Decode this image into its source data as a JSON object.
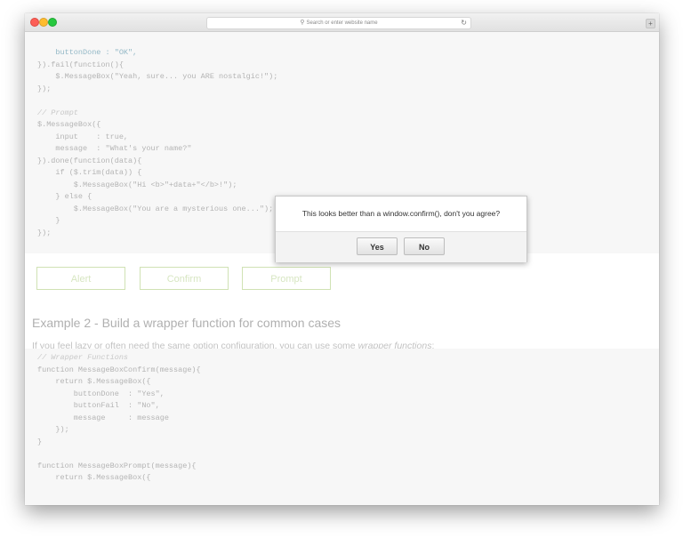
{
  "browser": {
    "address_placeholder": "Search or enter website name",
    "reload_icon": "reload-icon",
    "new_tab_label": "+"
  },
  "code1": {
    "lines": [
      [
        "c-prop",
        "    buttonDone : \"OK\","
      ],
      [
        "",
        "}).fail(function(){"
      ],
      [
        "",
        "    $.MessageBox(\"Yeah, sure... you ARE nostalgic!\");"
      ],
      [
        "",
        "});"
      ],
      [
        "",
        ""
      ],
      [
        "c-cm",
        "// Prompt"
      ],
      [
        "",
        "$.MessageBox({"
      ],
      [
        "",
        "    input    : true,"
      ],
      [
        "",
        "    message  : \"What's your name?\""
      ],
      [
        "",
        "}).done(function(data){"
      ],
      [
        "",
        "    if ($.trim(data)) {"
      ],
      [
        "",
        "        $.MessageBox(\"Hi <b>\"+data+\"</b>!\");"
      ],
      [
        "",
        "    } else {"
      ],
      [
        "",
        "        $.MessageBox(\"You are a mysterious one...\");"
      ],
      [
        "",
        "    }"
      ],
      [
        "",
        "});"
      ]
    ]
  },
  "buttons": {
    "alert": "Alert",
    "confirm": "Confirm",
    "prompt": "Prompt"
  },
  "example2": {
    "heading": "Example 2 - Build a wrapper function for common cases",
    "para_prefix": "If you feel lazy or often need the same option configuration, you can use some ",
    "para_em": "wrapper functions",
    "para_suffix": ":"
  },
  "code2": {
    "lines": [
      [
        "c-cm",
        "// Wrapper Functions"
      ],
      [
        "",
        "function MessageBoxConfirm(message){"
      ],
      [
        "",
        "    return $.MessageBox({"
      ],
      [
        "",
        "        buttonDone  : \"Yes\","
      ],
      [
        "",
        "        buttonFail  : \"No\","
      ],
      [
        "",
        "        message     : message"
      ],
      [
        "",
        "    });"
      ],
      [
        "",
        "}"
      ],
      [
        "",
        ""
      ],
      [
        "",
        "function MessageBoxPrompt(message){"
      ],
      [
        "",
        "    return $.MessageBox({"
      ]
    ]
  },
  "dialog": {
    "message": "This looks better than a window.confirm(), don't you agree?",
    "yes": "Yes",
    "no": "No"
  }
}
